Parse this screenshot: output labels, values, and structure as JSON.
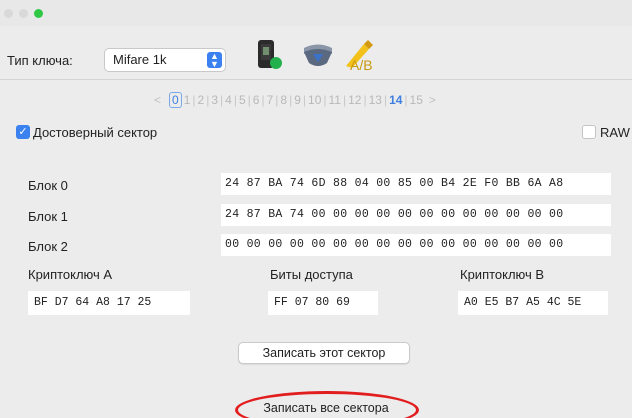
{
  "window": {
    "traffic_lights": [
      "close",
      "minimize",
      "maximize"
    ],
    "maximize_color": "#2fc845"
  },
  "toolbar": {
    "key_type_label": "Тип ключа:",
    "key_type_value": "Mifare 1k",
    "icons": [
      "reader-device-icon",
      "shield-down-icon",
      "a-b-swap-icon"
    ]
  },
  "pager": {
    "prev": "<",
    "next": ">",
    "pages": [
      "0",
      "1",
      "2",
      "3",
      "4",
      "5",
      "6",
      "7",
      "8",
      "9",
      "10",
      "11",
      "12",
      "13",
      "14",
      "15"
    ],
    "current": "0",
    "active": "14"
  },
  "sector": {
    "trusted_label": "Достоверный сектор",
    "trusted_checked": true,
    "raw_label": "RAW",
    "raw_checked": false
  },
  "blocks": [
    {
      "label": "Блок 0",
      "value": "24 87 BA 74 6D 88 04 00 85 00 B4 2E F0 BB 6A A8"
    },
    {
      "label": "Блок 1",
      "value": "24 87 BA 74 00 00 00 00 00 00 00 00 00 00 00 00"
    },
    {
      "label": "Блок 2",
      "value": "00 00 00 00 00 00 00 00 00 00 00 00 00 00 00 00"
    }
  ],
  "trailer": {
    "key_a_label": "Криптоключ A",
    "key_a_value": "BF D7 64 A8 17 25",
    "access_label": "Биты доступа",
    "access_value": "FF 07 80 69",
    "key_b_label": "Криптоключ B",
    "key_b_value": "A0 E5 B7 A5 4C 5E"
  },
  "actions": {
    "write_sector": "Записать этот сектор",
    "write_all": "Записать все сектора",
    "highlight_color": "#e21d1d"
  }
}
